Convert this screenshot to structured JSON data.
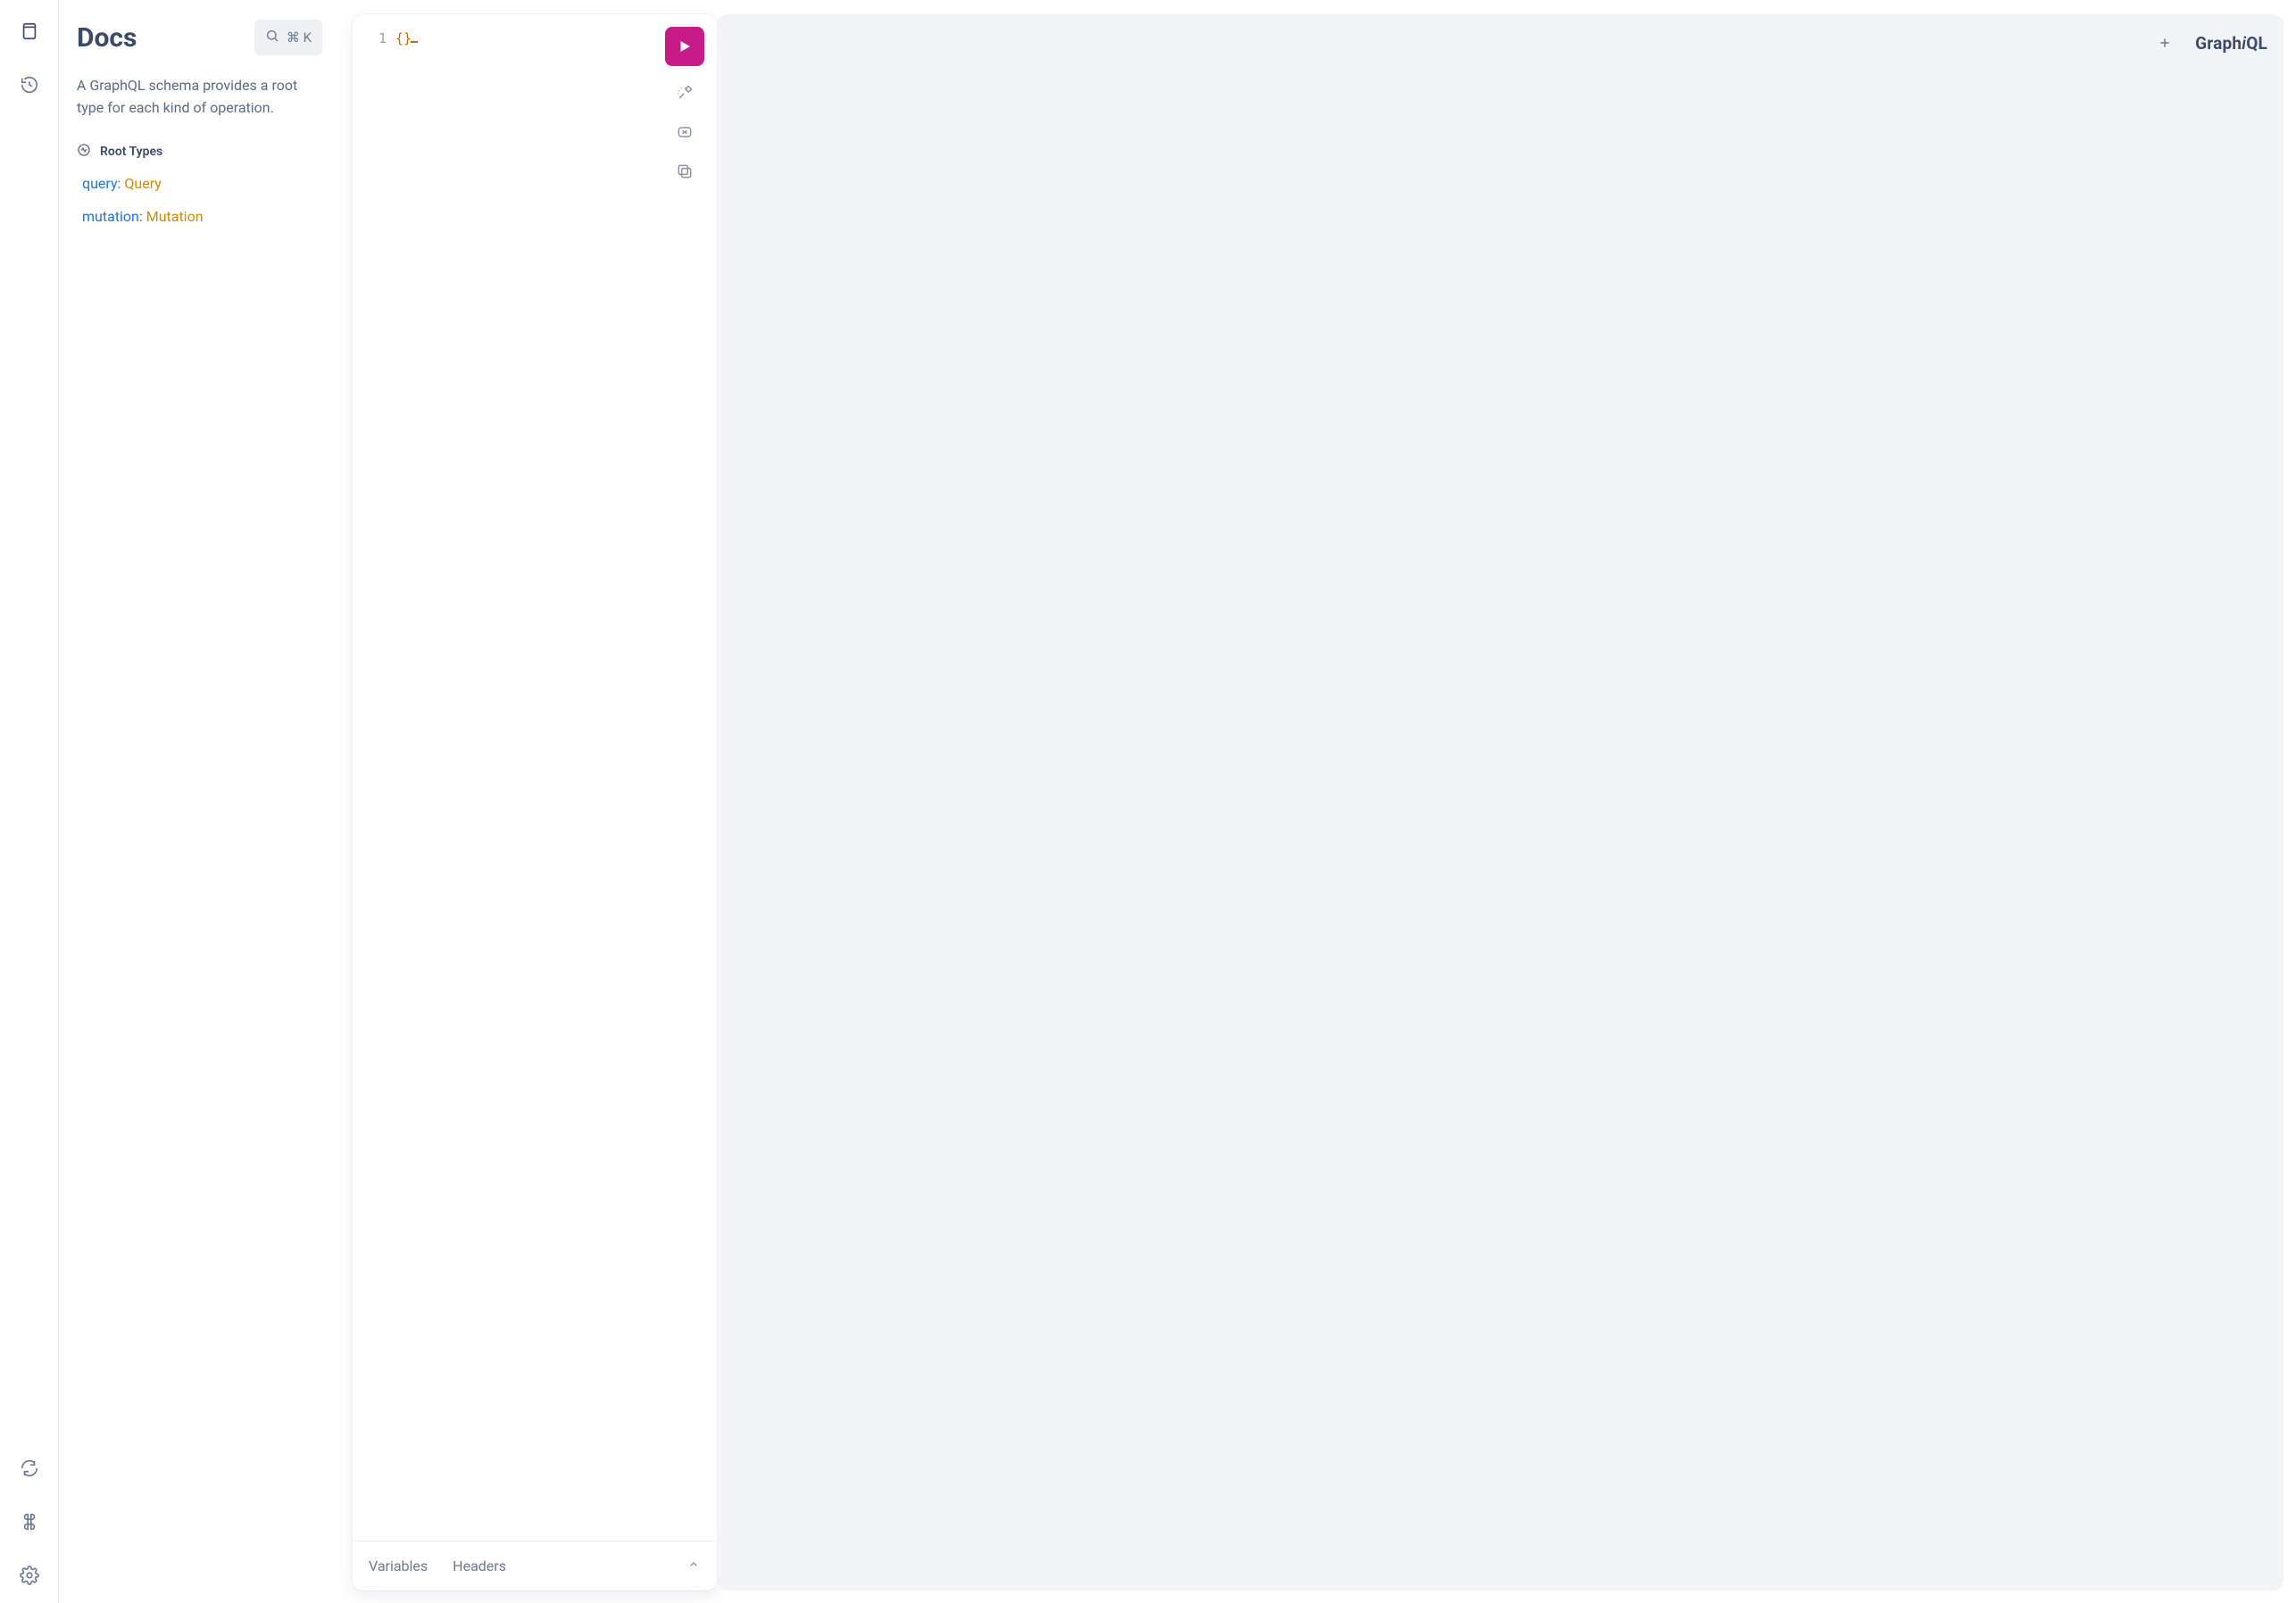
{
  "sidebar": {
    "icons": [
      "docs",
      "history",
      "refresh",
      "keyboard",
      "settings"
    ]
  },
  "docs": {
    "title": "Docs",
    "search_shortcut": "⌘ K",
    "description": "A GraphQL schema provides a root type for each kind of operation.",
    "root_types_label": "Root Types",
    "types": [
      {
        "key": "query",
        "name": "Query"
      },
      {
        "key": "mutation",
        "name": "Mutation"
      }
    ]
  },
  "editor": {
    "line_number": "1",
    "content": "{}",
    "footer_tabs": {
      "variables": "Variables",
      "headers": "Headers"
    }
  },
  "header": {
    "logo_prefix": "Graph",
    "logo_italic": "i",
    "logo_suffix": "QL"
  }
}
